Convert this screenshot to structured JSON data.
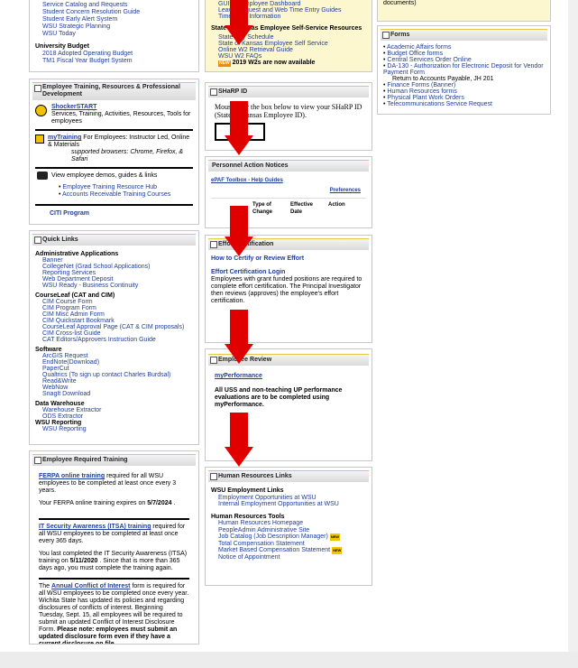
{
  "left_top_links": [
    "Service Catalog and Requests",
    "Student Concern Resolution Guide",
    "Student Early Alert System",
    "WSU Strategic Planning",
    "WSU Today"
  ],
  "university_budget": {
    "heading": "University Budget",
    "links": [
      "2018 Adopted Operating Budget",
      "TM1 Fiscal Year Budget System"
    ]
  },
  "training": {
    "title": "Employee Training, Resources & Professional Development",
    "shocker_start": "ShockerSTART",
    "shocker_desc": "Services, Training, Activities, Resources, Tools for employees",
    "mytraining": "myTraining",
    "mytraining_desc": " For Employees: Instructor Led, Online & Materials",
    "browsers": "supported browsers: Chrome, Firefox, & Safari",
    "demos": "View employee demos, guides & links",
    "links": [
      "Employee Training Resource Hub",
      "Accounts Receivable Training Courses"
    ],
    "citi": "CITI Program"
  },
  "quick_links": {
    "title": "Quick Links",
    "sections": [
      {
        "heading": "Administrative Applications",
        "items": [
          "Banner",
          "CollegeNet (Grad School Applications)",
          "Reporting Services",
          "Web Department Deposit",
          "WSU Ready - Business Continuity"
        ]
      },
      {
        "heading": "CourseLeaf (CAT and CIM)",
        "items": [
          "CIM Course Form",
          "CIM Program Form",
          "CIM Misc Admin Form",
          "CIM Quickstart Bookmark",
          "CourseLeaf Approval Page (CAT & CIM proposals)",
          "CIM Cross-list Guide",
          "CAT Editors/Approvers Instruction Guide"
        ]
      },
      {
        "heading": "Software",
        "items": [
          "ArcGIS Request",
          "EndNote(Download)",
          "PaperCut",
          "Qualtrics  (To sign up contact Charles Burdsal)",
          "Read&Write",
          "WebNow",
          "SnagIt Download"
        ]
      },
      {
        "heading": "Data Warehouse",
        "items": [
          "Warehouse Extractor",
          "ODS Extractor"
        ]
      },
      {
        "heading": "WSU Reporting",
        "items": [
          "WSU Reporting"
        ]
      }
    ]
  },
  "required_training": {
    "title": "Employee Required Training",
    "ferpa_link": "FERPA online training",
    "ferpa_text": " required for all WSU employees to be completed at least once every 3 years.",
    "ferpa_expires_pre": "Your FERPA online training expires on ",
    "ferpa_expires_date": "5/7/2024",
    "ferpa_expires_post": " .",
    "itsa_link": "IT Security Awareness (ITSA) training",
    "itsa_text": " required for all WSU employees to be completed at least once every 365 days.",
    "itsa_last_pre": "You last completed  the IT Security Awareness (ITSA) training on ",
    "itsa_last_date": "5/11/2020",
    "itsa_last_post": " .  Since that is more than 365 days ago, you must complete the training again.",
    "coi_pre": "The ",
    "coi_link": "Annual Conflict of Interest",
    "coi_text": " form is required for all WSU employees to be completed once every year. Wichita State has updated its policies and regarding disclosures of conflicts of interest. Beginning Tuesday, Sept. 15, all employees will be required to submit an updated Conflict of Interest Disclosure Form. ",
    "coi_bold": "Please note: employees must submit an updated disclosure form even if they have a current disclosure on file."
  },
  "mid_top": {
    "links_top": [
      "GUIDE Employee Dashboard",
      "Leave Request and Web Time Entry Guides",
      "Timesheet Information"
    ],
    "state_heading": "State of Kansas Employee Self-Service Resources",
    "state_links": [
      "State Pay Schedule",
      "State of Kansas Employee Self Service",
      "Online W2 Retrieval Guide",
      "WSU W2 FAQs"
    ],
    "w2_new": "NEW",
    "w2_text": "2019 W2s are now available"
  },
  "sharp": {
    "title": "SHaRP ID",
    "text": "Mouse over the box below to view your SHaRP ID (State of Kansas Employee ID)."
  },
  "personnel": {
    "title": "Personnel Action Notices",
    "epaf": "ePAF Toolbox - Help Guides",
    "preferences": "Preferences",
    "columns": [
      "Type of Change",
      "Effective Date",
      "Action"
    ]
  },
  "effort": {
    "title": "Effort Certification",
    "how_to": "How to Certify or Review Effort",
    "login": "Effort Certification Login",
    "desc": "Employees with grant funded positions are required to complete effort certification. The Principal Investigator then reviews (approves) the employee's effort certification."
  },
  "review": {
    "title": "Employee Review",
    "link": "myPerformance",
    "desc": "All USS and non-teaching UP performance evaluations are to be completed using myPerformance."
  },
  "hr": {
    "title": "Human Resources Links",
    "wsu_heading": "WSU Employment Links",
    "wsu_links": [
      "Employment Opportunities at WSU",
      "Internal Employment Opportunities at WSU"
    ],
    "tools_heading": "Human Resources Tools",
    "tools": [
      "Human Resources Homepage",
      "PeopleAdmin Administrative Site",
      "Job Catalog (Job Description Manager)",
      "Total Compensation Statement",
      "Market Based Compensation Statement",
      "Notice of Appointment"
    ],
    "new_label": "NEW"
  },
  "right_top": {
    "documents": "documents)"
  },
  "forms": {
    "title": "Forms",
    "items": [
      "Academic Affairs forms",
      "Budget Office forms",
      "Central Services Order Online",
      "DA-130 - Authorization for Electronic Deposit for Vendor Payment Form"
    ],
    "return_line": "Return to Accounts Payable, JH 201",
    "items2": [
      "Finance Forms (Banner)",
      "Human Resources forms",
      "Physical Plant Work Orders",
      "Telecommunications Service Request"
    ]
  },
  "colors": {
    "link": "#1f3e9a",
    "arrow": "#e00000",
    "highlight": "#fdf7cf"
  }
}
